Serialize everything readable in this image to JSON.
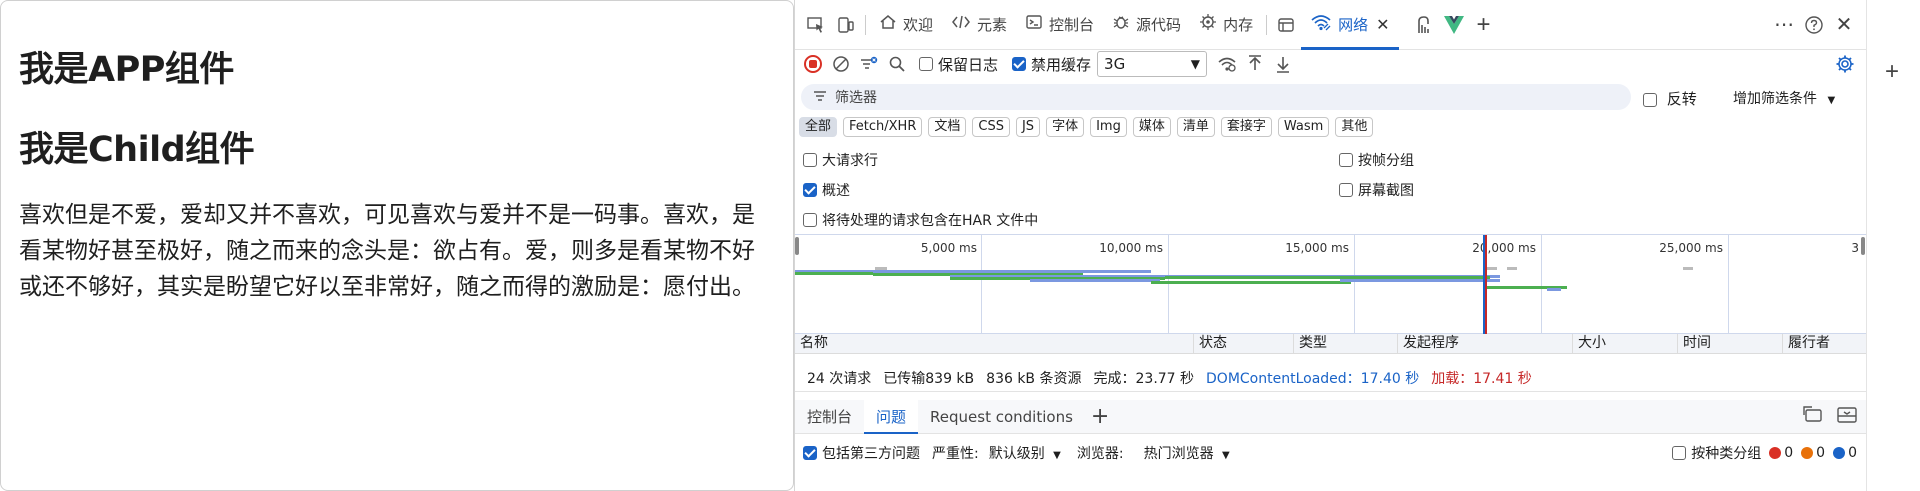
{
  "page": {
    "heading_app": "我是APP组件",
    "heading_child": "我是Child组件",
    "paragraph": "喜欢但是不爱，爱却又并不喜欢，可见喜欢与爱并不是一码事。喜欢，是看某物好甚至极好，随之而来的念头是：欲占有。爱，则多是看某物不好或还不够好，其实是盼望它好以至非常好，随之而得的激励是：愿付出。"
  },
  "devtools": {
    "tabs": [
      {
        "label": "欢迎",
        "icon": "home-icon"
      },
      {
        "label": "元素",
        "icon": "code-icon"
      },
      {
        "label": "控制台",
        "icon": "terminal-icon"
      },
      {
        "label": "源代码",
        "icon": "bug-icon"
      },
      {
        "label": "内存",
        "icon": "memory-icon"
      },
      {
        "label": "网络",
        "icon": "wifi-icon",
        "active": true
      }
    ],
    "toolbar": {
      "preserve_log": "保留日志",
      "disable_cache": "禁用缓存",
      "throttle": "3G"
    },
    "filter": {
      "placeholder": "筛选器",
      "invert": "反转",
      "more_filters": "增加筛选条件"
    },
    "types": [
      "全部",
      "Fetch/XHR",
      "文档",
      "CSS",
      "JS",
      "字体",
      "Img",
      "媒体",
      "清单",
      "套接字",
      "Wasm",
      "其他"
    ],
    "options": {
      "big_rows": "大请求行",
      "group_by_frame": "按帧分组",
      "overview": "概述",
      "screenshots": "屏幕截图",
      "har_pending": "将待处理的请求包含在HAR 文件中"
    },
    "overview_ticks": [
      "5,000 ms",
      "10,000 ms",
      "15,000 ms",
      "20,000 ms",
      "25,000 ms",
      "3"
    ],
    "columns": [
      "名称",
      "状态",
      "类型",
      "发起程序",
      "大小",
      "时间",
      "履行者"
    ],
    "status": {
      "requests": "24 次请求",
      "transferred": "已传输839 kB",
      "resources": "836 kB 条资源",
      "finish": "完成：23.77 秒",
      "dcl": "DOMContentLoaded：17.40 秒",
      "load": "加载：17.41 秒"
    },
    "drawer": {
      "tabs": [
        "控制台",
        "问题",
        "Request conditions"
      ],
      "include_third_party": "包括第三方问题",
      "severity_label": "严重性:",
      "severity_value": "默认级别",
      "browser_label": "浏览器:",
      "browser_value": "热门浏览器",
      "group_by_kind": "按种类分组",
      "counts": [
        "0",
        "0",
        "0"
      ]
    },
    "colors": {
      "accent": "#1a63c7",
      "error": "#d93025",
      "dcl_line": "#1a63c7",
      "load_line": "#c62828"
    }
  }
}
